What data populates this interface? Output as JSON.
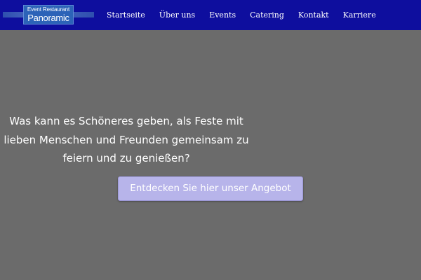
{
  "header": {
    "logo": {
      "line1": "Event Restaurant",
      "line2": "Panoramic"
    },
    "nav": [
      {
        "label": "Startseite"
      },
      {
        "label": "Über uns"
      },
      {
        "label": "Events"
      },
      {
        "label": "Catering"
      },
      {
        "label": "Kontakt"
      },
      {
        "label": "Karriere"
      }
    ]
  },
  "hero": {
    "text": "Was kann es Schöneres geben, als Feste mit lieben Menschen und Freunden gemeinsam zu feiern und zu genießen?",
    "cta_label": "Entdecken Sie hier unser Angebot"
  },
  "colors": {
    "header_bg": "#0e0e9e",
    "page_bg": "#6b6b6b",
    "cta_bg": "#b7b4ea",
    "logo_bg": "#2c63b8"
  }
}
